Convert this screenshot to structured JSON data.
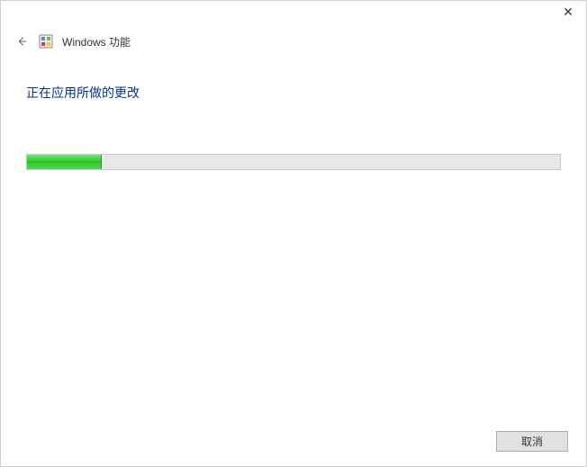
{
  "window": {
    "close_symbol": "✕"
  },
  "header": {
    "title": "Windows 功能"
  },
  "content": {
    "heading": "正在应用所做的更改"
  },
  "progress": {
    "percent": 14
  },
  "footer": {
    "cancel_label": "取消"
  }
}
